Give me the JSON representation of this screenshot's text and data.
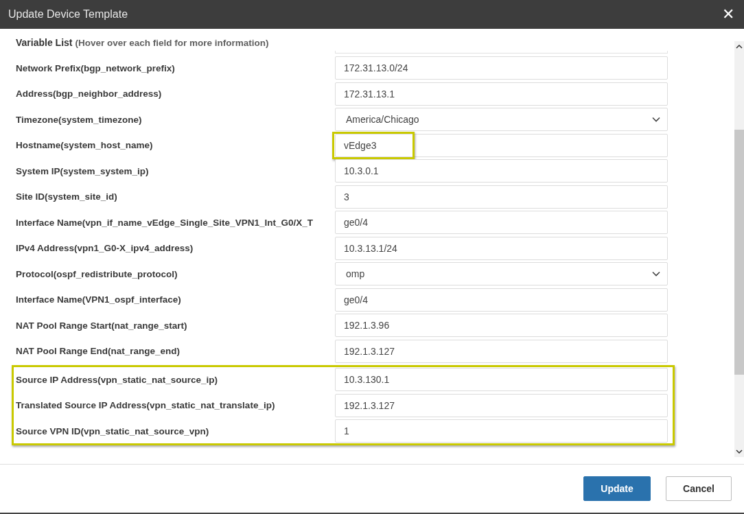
{
  "window": {
    "title": "Update Device Template",
    "close": "✕"
  },
  "heading": {
    "title": "Variable List",
    "hint": "(Hover over each field for more information)"
  },
  "rows": [
    {
      "label": "Network Prefix(bgp_network_prefix)",
      "kind": "text",
      "value": "172.31.13.0/24",
      "value_boxed": false,
      "row_boxed": false
    },
    {
      "label": "Address(bgp_neighbor_address)",
      "kind": "text",
      "value": "172.31.13.1",
      "value_boxed": false,
      "row_boxed": false
    },
    {
      "label": "Timezone(system_timezone)",
      "kind": "select",
      "value": "America/Chicago",
      "value_boxed": false,
      "row_boxed": false
    },
    {
      "label": "Hostname(system_host_name)",
      "kind": "text",
      "value": "vEdge3",
      "value_boxed": true,
      "row_boxed": false
    },
    {
      "label": "System IP(system_system_ip)",
      "kind": "text",
      "value": "10.3.0.1",
      "value_boxed": false,
      "row_boxed": false
    },
    {
      "label": "Site ID(system_site_id)",
      "kind": "text",
      "value": "3",
      "value_boxed": false,
      "row_boxed": false
    },
    {
      "label": "Interface Name(vpn_if_name_vEdge_Single_Site_VPN1_Int_G0/X_T",
      "kind": "text",
      "value": "ge0/4",
      "value_boxed": false,
      "row_boxed": false
    },
    {
      "label": "IPv4 Address(vpn1_G0-X_ipv4_address)",
      "kind": "text",
      "value": "10.3.13.1/24",
      "value_boxed": false,
      "row_boxed": false
    },
    {
      "label": "Protocol(ospf_redistribute_protocol)",
      "kind": "select",
      "value": "omp",
      "value_boxed": false,
      "row_boxed": false
    },
    {
      "label": "Interface Name(VPN1_ospf_interface)",
      "kind": "text",
      "value": "ge0/4",
      "value_boxed": false,
      "row_boxed": false
    },
    {
      "label": "NAT Pool Range Start(nat_range_start)",
      "kind": "text",
      "value": "192.1.3.96",
      "value_boxed": false,
      "row_boxed": false
    },
    {
      "label": "NAT Pool Range End(nat_range_end)",
      "kind": "text",
      "value": "192.1.3.127",
      "value_boxed": false,
      "row_boxed": false
    },
    {
      "label": "Source IP Address(vpn_static_nat_source_ip)",
      "kind": "text",
      "value": "10.3.130.1",
      "value_boxed": false,
      "row_boxed": true
    },
    {
      "label": "Translated Source IP Address(vpn_static_nat_translate_ip)",
      "kind": "text",
      "value": "192.1.3.127",
      "value_boxed": false,
      "row_boxed": true
    },
    {
      "label": "Source VPN ID(vpn_static_nat_source_vpn)",
      "kind": "text",
      "value": "1",
      "value_boxed": false,
      "row_boxed": true
    }
  ],
  "buttons": [
    {
      "label": "Update",
      "kind": "primary"
    },
    {
      "label": "Cancel",
      "kind": "secondary"
    }
  ]
}
